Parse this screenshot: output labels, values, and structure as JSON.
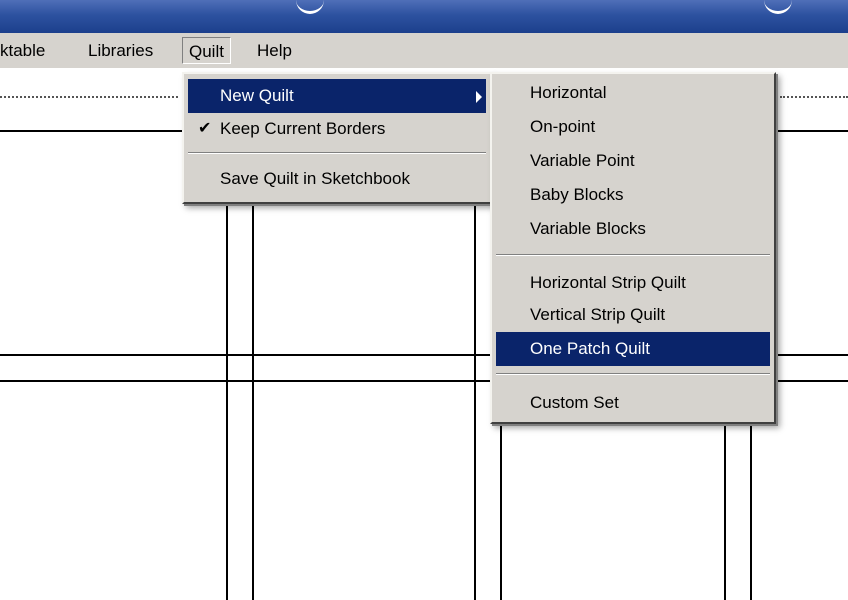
{
  "menubar": {
    "items": [
      {
        "label": "ktable"
      },
      {
        "label": "Libraries"
      },
      {
        "label": "Quilt"
      },
      {
        "label": "Help"
      }
    ]
  },
  "quilt_menu": {
    "items": [
      {
        "label": "New Quilt",
        "has_submenu": true,
        "highlighted": true
      },
      {
        "label": "Keep Current Borders",
        "checked": true
      },
      {
        "label": "Save Quilt in Sketchbook"
      }
    ]
  },
  "new_quilt_submenu": {
    "items": [
      {
        "label": "Horizontal"
      },
      {
        "label": "On-point"
      },
      {
        "label": "Variable Point"
      },
      {
        "label": "Baby Blocks"
      },
      {
        "label": "Variable Blocks"
      },
      {
        "label": "Horizontal Strip Quilt"
      },
      {
        "label": "Vertical Strip Quilt"
      },
      {
        "label": "One Patch Quilt",
        "highlighted": true
      },
      {
        "label": "Custom Set"
      }
    ]
  },
  "icons": {
    "checked": "checkmark-icon",
    "submenu": "submenu-arrow-icon"
  },
  "colors": {
    "titlebar": "#2d52a0",
    "menu_background": "#d6d3ce",
    "highlight": "#0a246a",
    "highlight_text": "#ffffff"
  }
}
